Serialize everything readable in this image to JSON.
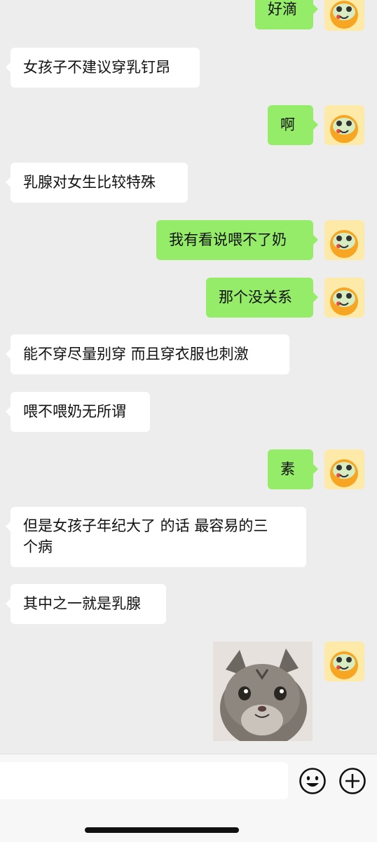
{
  "messages": [
    {
      "dir": "out",
      "text": "好滴"
    },
    {
      "dir": "in",
      "text": "女孩子不建议穿乳钉昂"
    },
    {
      "dir": "out",
      "text": "啊"
    },
    {
      "dir": "in",
      "text": "乳腺对女生比较特殊"
    },
    {
      "dir": "out",
      "text": "我有看说喂不了奶"
    },
    {
      "dir": "out",
      "text": "那个没关系"
    },
    {
      "dir": "in",
      "text": "能不穿尽量别穿 而且穿衣服也刺激"
    },
    {
      "dir": "in",
      "text": "喂不喂奶无所谓"
    },
    {
      "dir": "out",
      "text": "素"
    },
    {
      "dir": "in",
      "text": "但是女孩子年纪大了 的话 最容易的三\n个病"
    },
    {
      "dir": "in",
      "text": "其中之一就是乳腺"
    },
    {
      "dir": "out",
      "type": "image",
      "text": ""
    }
  ],
  "input": {
    "value": "",
    "placeholder": ""
  },
  "icons": {
    "emoji": "smiley-face-icon",
    "more": "plus-circle-icon"
  },
  "colors": {
    "outgoing": "#95ec69",
    "incoming": "#ffffff",
    "background": "#ededed"
  }
}
